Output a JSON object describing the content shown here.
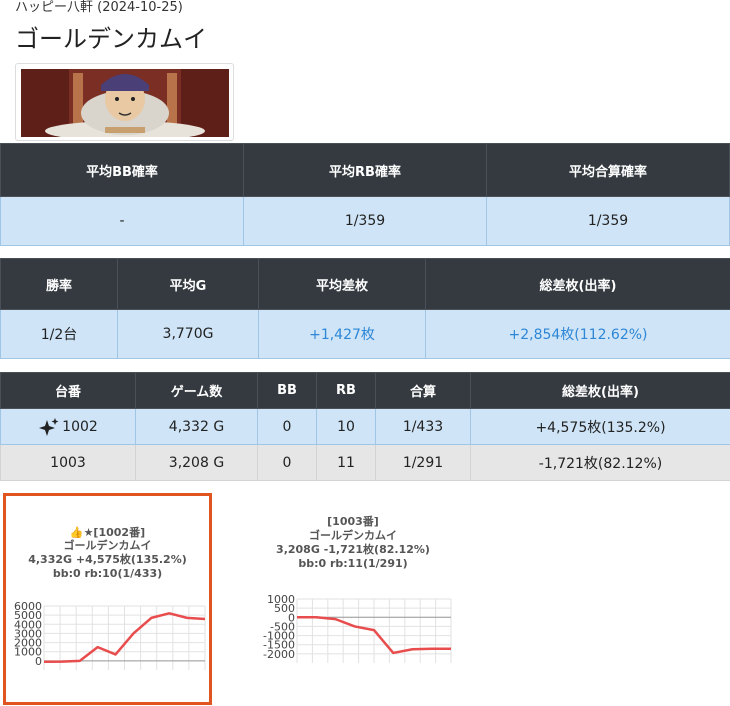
{
  "header": {
    "subtitle": "ハッピー八軒 (2024-10-25)",
    "title": "ゴールデンカムイ"
  },
  "summary1": {
    "headers": [
      "平均BB確率",
      "平均RB確率",
      "平均合算確率"
    ],
    "values": [
      "-",
      "1/359",
      "1/359"
    ]
  },
  "summary2": {
    "headers": [
      "勝率",
      "平均G",
      "平均差枚",
      "総差枚(出率)"
    ],
    "values": [
      "1/2台",
      "3,770G",
      "+1,427枚",
      "+2,854枚(112.62%)"
    ]
  },
  "machines": {
    "headers": [
      "台番",
      "ゲーム数",
      "BB",
      "RB",
      "合算",
      "総差枚(出率)"
    ],
    "rows": [
      {
        "num": "1002",
        "games": "4,332 G",
        "bb": "0",
        "rb": "10",
        "total": "1/433",
        "diff": "+4,575枚(135.2%)"
      },
      {
        "num": "1003",
        "games": "3,208 G",
        "bb": "0",
        "rb": "11",
        "total": "1/291",
        "diff": "-1,721枚(82.12%)"
      }
    ]
  },
  "cards": [
    {
      "line1": "👍★[1002番]",
      "line2": "ゴールデンカムイ",
      "line3": "4,332G +4,575枚(135.2%)",
      "line4": "bb:0 rb:10(1/433)"
    },
    {
      "line1": "[1003番]",
      "line2": "ゴールデンカムイ",
      "line3": "3,208G -1,721枚(82.12%)",
      "line4": "bb:0 rb:11(1/291)"
    }
  ],
  "colors": {
    "line": "#e84c4c",
    "header_bg": "#343a40",
    "row_blue": "#cfe5f7",
    "positive": "#2e86d6",
    "highlight_border": "#e0541f"
  },
  "chart_data": [
    {
      "type": "line",
      "ylim": [
        -1000,
        6000
      ],
      "yticks": [
        "6000",
        "5000",
        "4000",
        "3000",
        "2000",
        "1000",
        "0"
      ],
      "x": [
        0,
        1,
        2,
        3,
        4,
        5,
        6,
        7,
        8,
        9
      ],
      "values": [
        -100,
        -80,
        0,
        1500,
        700,
        3000,
        4700,
        5200,
        4700,
        4575
      ],
      "grid": true
    },
    {
      "type": "line",
      "ylim": [
        -2500,
        1000
      ],
      "yticks": [
        "1000",
        "500",
        "0",
        "-500",
        "-1000",
        "-1500",
        "-2000"
      ],
      "x": [
        0,
        1,
        2,
        3,
        4,
        5,
        6,
        7,
        8
      ],
      "values": [
        0,
        0,
        -100,
        -500,
        -700,
        -1950,
        -1750,
        -1721,
        -1721
      ],
      "grid": true
    }
  ]
}
